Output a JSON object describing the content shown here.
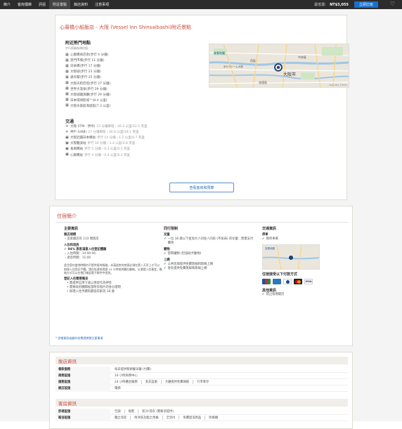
{
  "nav": {
    "tabs": [
      "簡介",
      "客房價庫",
      "評語",
      "附近景點",
      "飯店資料",
      "注意事項"
    ],
    "active_tab_index": 3,
    "price_label": "最低價：",
    "price_value": "NT$3,055",
    "book_button": "立即訂房",
    "heart_icon": "heart-icon"
  },
  "nearby": {
    "section_title": "心齋橋小船飯店 - 大阪 (Vessel Inn Shinsaibashi)附近景點",
    "popular_heading": "附近熱門地點",
    "popular_note": "步行距離為預估值",
    "popular_items": [
      {
        "name": "心齋橋商店街",
        "dist": "(步行 4 分鐘)"
      },
      {
        "name": "黑門市場",
        "dist": "(步行 11 分鐘)"
      },
      {
        "name": "日本橋",
        "dist": "(步行 17 分鐘)"
      },
      {
        "name": "大阪城",
        "dist": "(步行 23 分鐘)"
      },
      {
        "name": "通天閣",
        "dist": "(步行 25 分鐘)"
      },
      {
        "name": "大阪天狗巨塔",
        "dist": "(步行 27 分鐘)"
      },
      {
        "name": "世界大溫泉",
        "dist": "(步行 29 分鐘)"
      },
      {
        "name": "大阪城鐵演廳",
        "dist": "(步行 29 分鐘)"
      },
      {
        "name": "日本環球影城™",
        "dist": "(8.4 公里)"
      },
      {
        "name": "大阪水族館海遊館",
        "dist": "(7.3 公里)"
      }
    ],
    "transport_heading": "交通",
    "transport_items": [
      {
        "icon": "plane-icon",
        "name": "大阪 (ITM - 伊丹)",
        "dist": "23 分鐘車程・20.2 公里/12.5 英里"
      },
      {
        "icon": "plane-icon",
        "name": "神戶 (UKB)",
        "dist": "27 分鐘車程・30.8 公里/19.1 英里"
      },
      {
        "icon": "train-icon",
        "name": "大阪近鐵日本橋站",
        "dist": "步行 14 分鐘・1.2 公里/0.7 英里"
      },
      {
        "icon": "train-icon",
        "name": "大阪難波站",
        "dist": "步行 16 分鐘・1.3 公里/0.8 英里"
      },
      {
        "icon": "train-icon",
        "name": "長堀橋站",
        "dist": "步行 5 分鐘・0.3 公里/0.2 英里"
      },
      {
        "icon": "train-icon",
        "name": "心齋橋站",
        "dist": "步行 4 分鐘・0.4 公里/0.2 英里"
      }
    ],
    "map_button": "查看客房和預算",
    "map_labels": {
      "title": "查看地圖",
      "city": "大阪市",
      "district1": "西區",
      "district2": "中央區",
      "district3": "浪速區",
      "dome": "京セラドーム大阪",
      "credit": "Map data ©2020"
    }
  },
  "overview": {
    "section_title": "住宿簡介",
    "main_info": {
      "title": "主要資訊",
      "room_label": "飯店規模",
      "room_text": "・這家飯店有 133 間客房",
      "arrive_label": "入住和退房",
      "stat_text": "94% 旅客滿意入住登記體驗",
      "checkin_text": "・入住時間：14:00:00",
      "checkout_text": "・退房時間：11:00",
      "desc": "此住宿在當地時間內不提供接待服務。未滿退房的房客必須在第二天早上才可以辦理入住登記手續。請在抵達前透過 24 小時前與櫃台聯絡，以便請入住事宜。聯絡方式可以在預訂確認電子郵件中找到。",
      "prep_label": "登記入住需要備妥",
      "prep_items": [
        "需提供信用卡或以現金作為押金",
        "需要政府機關核發附有照片的身分證明",
        "辦理入住手續的最低年齡為 18 歲"
      ]
    },
    "travel_policy": {
      "title": "同行限制",
      "children_label": "兒童",
      "children_text": "一位 18 歲以下並與大人同住人同房 (不加床) 的兒童：無需支付費用",
      "pets_label": "寵物",
      "pets_text": "禁帶寵物 (但協助犬動物)",
      "internet_label": "上網",
      "internet_items": [
        "公共區域提供免費無線和無線上網",
        "客房提供免費無線和無線上網"
      ]
    },
    "transport": {
      "title": "交通資訊",
      "parking_label": "停車",
      "parking_text": "無停車場",
      "map_label": "查看地圖",
      "payment_title": "住宿接受以下付款方式",
      "cards": [
        "JCB",
        "AMEX",
        "DINERS",
        "MC",
        "VISA"
      ],
      "other_title": "其他資訊",
      "other_text": "禁止吸煙飯店"
    },
    "footnote": "* 詳細資訊或額外收費請參閱注意事項"
  },
  "hotel_info": {
    "section_title": "飯店資訊",
    "rows": [
      {
        "key": "餐飲服務",
        "values": [
          "每日提供和朝餐早餐 (付費)"
        ]
      },
      {
        "key": "商務設施",
        "values": [
          "24 小時商務中心"
        ]
      },
      {
        "key": "服務設施",
        "values": [
          "24 小時櫃台服務",
          "洗衣設施",
          "大廳提供免費報紙",
          "行李寄存"
        ]
      },
      {
        "key": "飯店設施",
        "values": [
          "電梯"
        ]
      }
    ]
  },
  "room_info": {
    "section_title": "客房資訊",
    "rows": [
      {
        "key": "舒適設施",
        "values": [
          "空調",
          "拖鞋",
          "乾冷/浴衣 (需要求提供)"
        ]
      },
      {
        "key": "衛浴設施",
        "values": [
          "獨立浴室",
          "附沖洗功能之馬桶",
          "全浴巾",
          "免費盥洗用品",
          "吹風機"
        ]
      }
    ]
  }
}
